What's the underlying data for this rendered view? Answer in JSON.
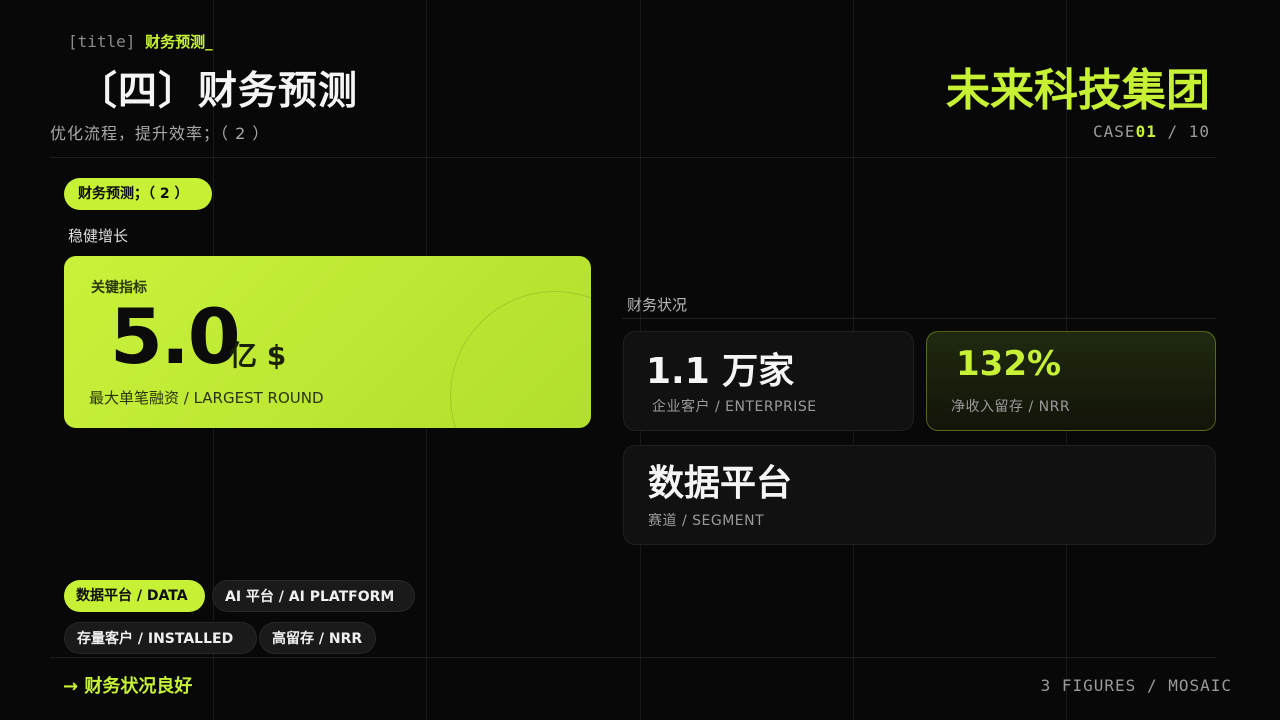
{
  "header": {
    "title_tag_prefix": "[title]",
    "title_tag_highlight": "财务预测_",
    "title": "〔四〕财务预测",
    "subtitle": "优化流程，提升效率；（ 2 ）",
    "brand": "未来科技集团",
    "case_prefix": "CASE",
    "case_number": "01",
    "case_total": "/ 10"
  },
  "left": {
    "pill_tag": "财务预测；（ 2 ）",
    "growth_label": "稳健增长",
    "hero": {
      "label": "关键指标",
      "value": "5.0",
      "unit": "亿 $",
      "caption": "最大单笔融资 / LARGEST ROUND"
    },
    "chips": [
      {
        "label": "数据平台 / DATA",
        "active": true
      },
      {
        "label": "AI 平台 / AI PLATFORM",
        "active": false
      },
      {
        "label": "存量客户 / INSTALLED",
        "active": false
      },
      {
        "label": "高留存 / NRR",
        "active": false
      }
    ]
  },
  "right": {
    "section_label": "财务状况",
    "cards": [
      {
        "value": "1.1 万家",
        "caption": "企业客户 / ENTERPRISE"
      },
      {
        "value": "132%",
        "caption": "净收入留存 / NRR"
      },
      {
        "value": "数据平台",
        "caption": "赛道 / SEGMENT"
      }
    ]
  },
  "footer": {
    "link": "→ 财务状况良好",
    "meta": "3 FIGURES / MOSAIC"
  },
  "colors": {
    "accent": "#c6f135",
    "background": "#080808"
  }
}
